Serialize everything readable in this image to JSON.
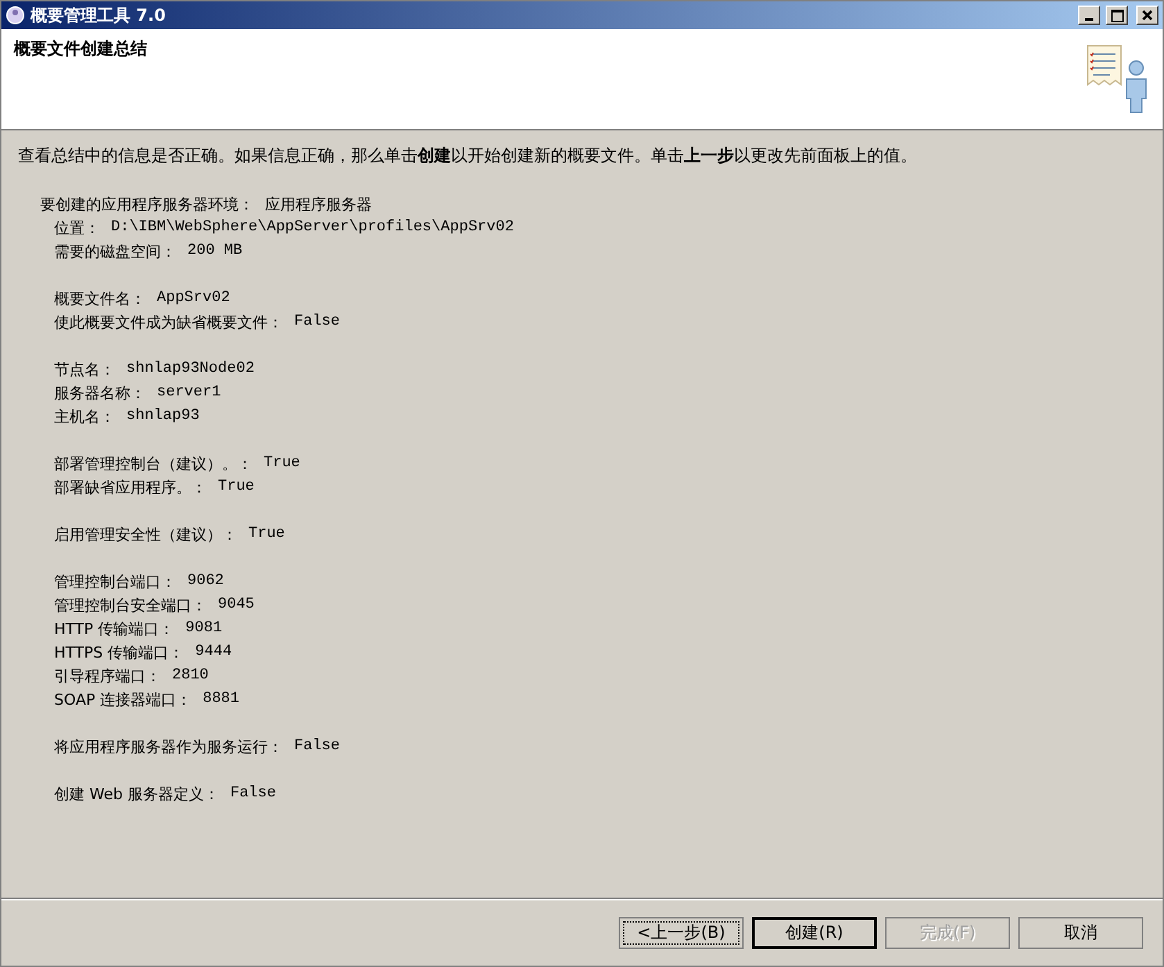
{
  "window": {
    "title": "概要管理工具 7.0"
  },
  "header": {
    "title": "概要文件创建总结"
  },
  "instruction": "查看总结中的信息是否正确。如果信息正确，那么单击**创建**以开始创建新的概要文件。单击**上一步**以更改先前面板上的值。",
  "summary": {
    "environment": {
      "label": "要创建的应用程序服务器环境：",
      "value": "应用程序服务器"
    },
    "groups": [
      [
        {
          "label": "位置：",
          "value": "D:\\IBM\\WebSphere\\AppServer\\profiles\\AppSrv02"
        },
        {
          "label": "需要的磁盘空间：",
          "value": "200 MB"
        }
      ],
      [
        {
          "label": "概要文件名：",
          "value": "AppSrv02"
        },
        {
          "label": "使此概要文件成为缺省概要文件：",
          "value": "False"
        }
      ],
      [
        {
          "label": "节点名：",
          "value": "shnlap93Node02"
        },
        {
          "label": "服务器名称：",
          "value": "server1"
        },
        {
          "label": "主机名：",
          "value": "shnlap93"
        }
      ],
      [
        {
          "label": "部署管理控制台（建议）。：",
          "value": "True"
        },
        {
          "label": "部署缺省应用程序。：",
          "value": "True"
        }
      ],
      [
        {
          "label": "启用管理安全性（建议）：",
          "value": "True"
        }
      ],
      [
        {
          "label": "管理控制台端口：",
          "value": "9062"
        },
        {
          "label": "管理控制台安全端口：",
          "value": "9045"
        },
        {
          "label": "HTTP 传输端口：",
          "value": "9081"
        },
        {
          "label": "HTTPS 传输端口：",
          "value": "9444"
        },
        {
          "label": "引导程序端口：",
          "value": "2810"
        },
        {
          "label": "SOAP 连接器端口：",
          "value": "8881"
        }
      ],
      [
        {
          "label": "将应用程序服务器作为服务运行：",
          "value": "False"
        }
      ],
      [
        {
          "label": "创建 Web 服务器定义：",
          "value": "False"
        }
      ]
    ]
  },
  "buttons": [
    {
      "label": "<上一步(B)",
      "focused": true,
      "default": false,
      "disabled": false
    },
    {
      "label": "创建(R)",
      "focused": false,
      "default": true,
      "disabled": false
    },
    {
      "label": "完成(F)",
      "focused": false,
      "default": false,
      "disabled": true
    },
    {
      "label": "取消",
      "focused": false,
      "default": false,
      "disabled": false
    }
  ]
}
